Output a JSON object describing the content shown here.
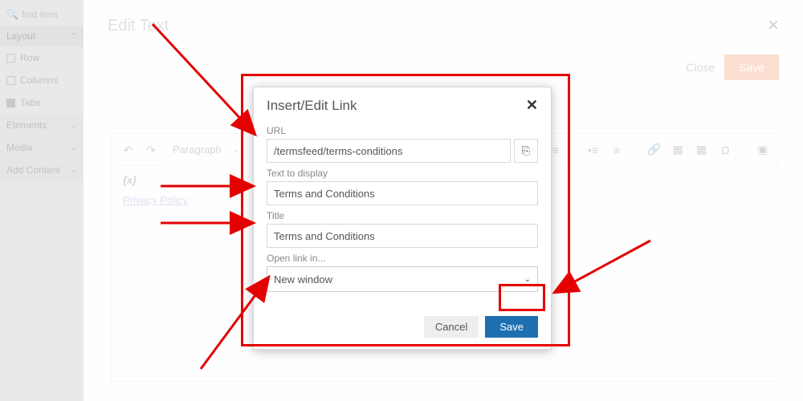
{
  "sidebar": {
    "search_placeholder": "find item",
    "layout_header": "Layout",
    "items": [
      "Row",
      "Columns",
      "Tabs"
    ],
    "sections": [
      "Elements",
      "Media",
      "Add Content"
    ]
  },
  "editHeader": {
    "title": "Edit Text",
    "close_btn": "Close",
    "save_btn": "Save"
  },
  "toolbar": {
    "format_select": "Paragraph"
  },
  "editor": {
    "vars": "{x}",
    "link_text": "Privacy Policy"
  },
  "linkModal": {
    "title": "Insert/Edit Link",
    "url_label": "URL",
    "url_value": "/termsfeed/terms-conditions",
    "text_label": "Text to display",
    "text_value": "Terms and Conditions",
    "title_label": "Title",
    "title_value": "Terms and Conditions",
    "open_label": "Open link in...",
    "open_value": "New window",
    "cancel": "Cancel",
    "save": "Save"
  }
}
